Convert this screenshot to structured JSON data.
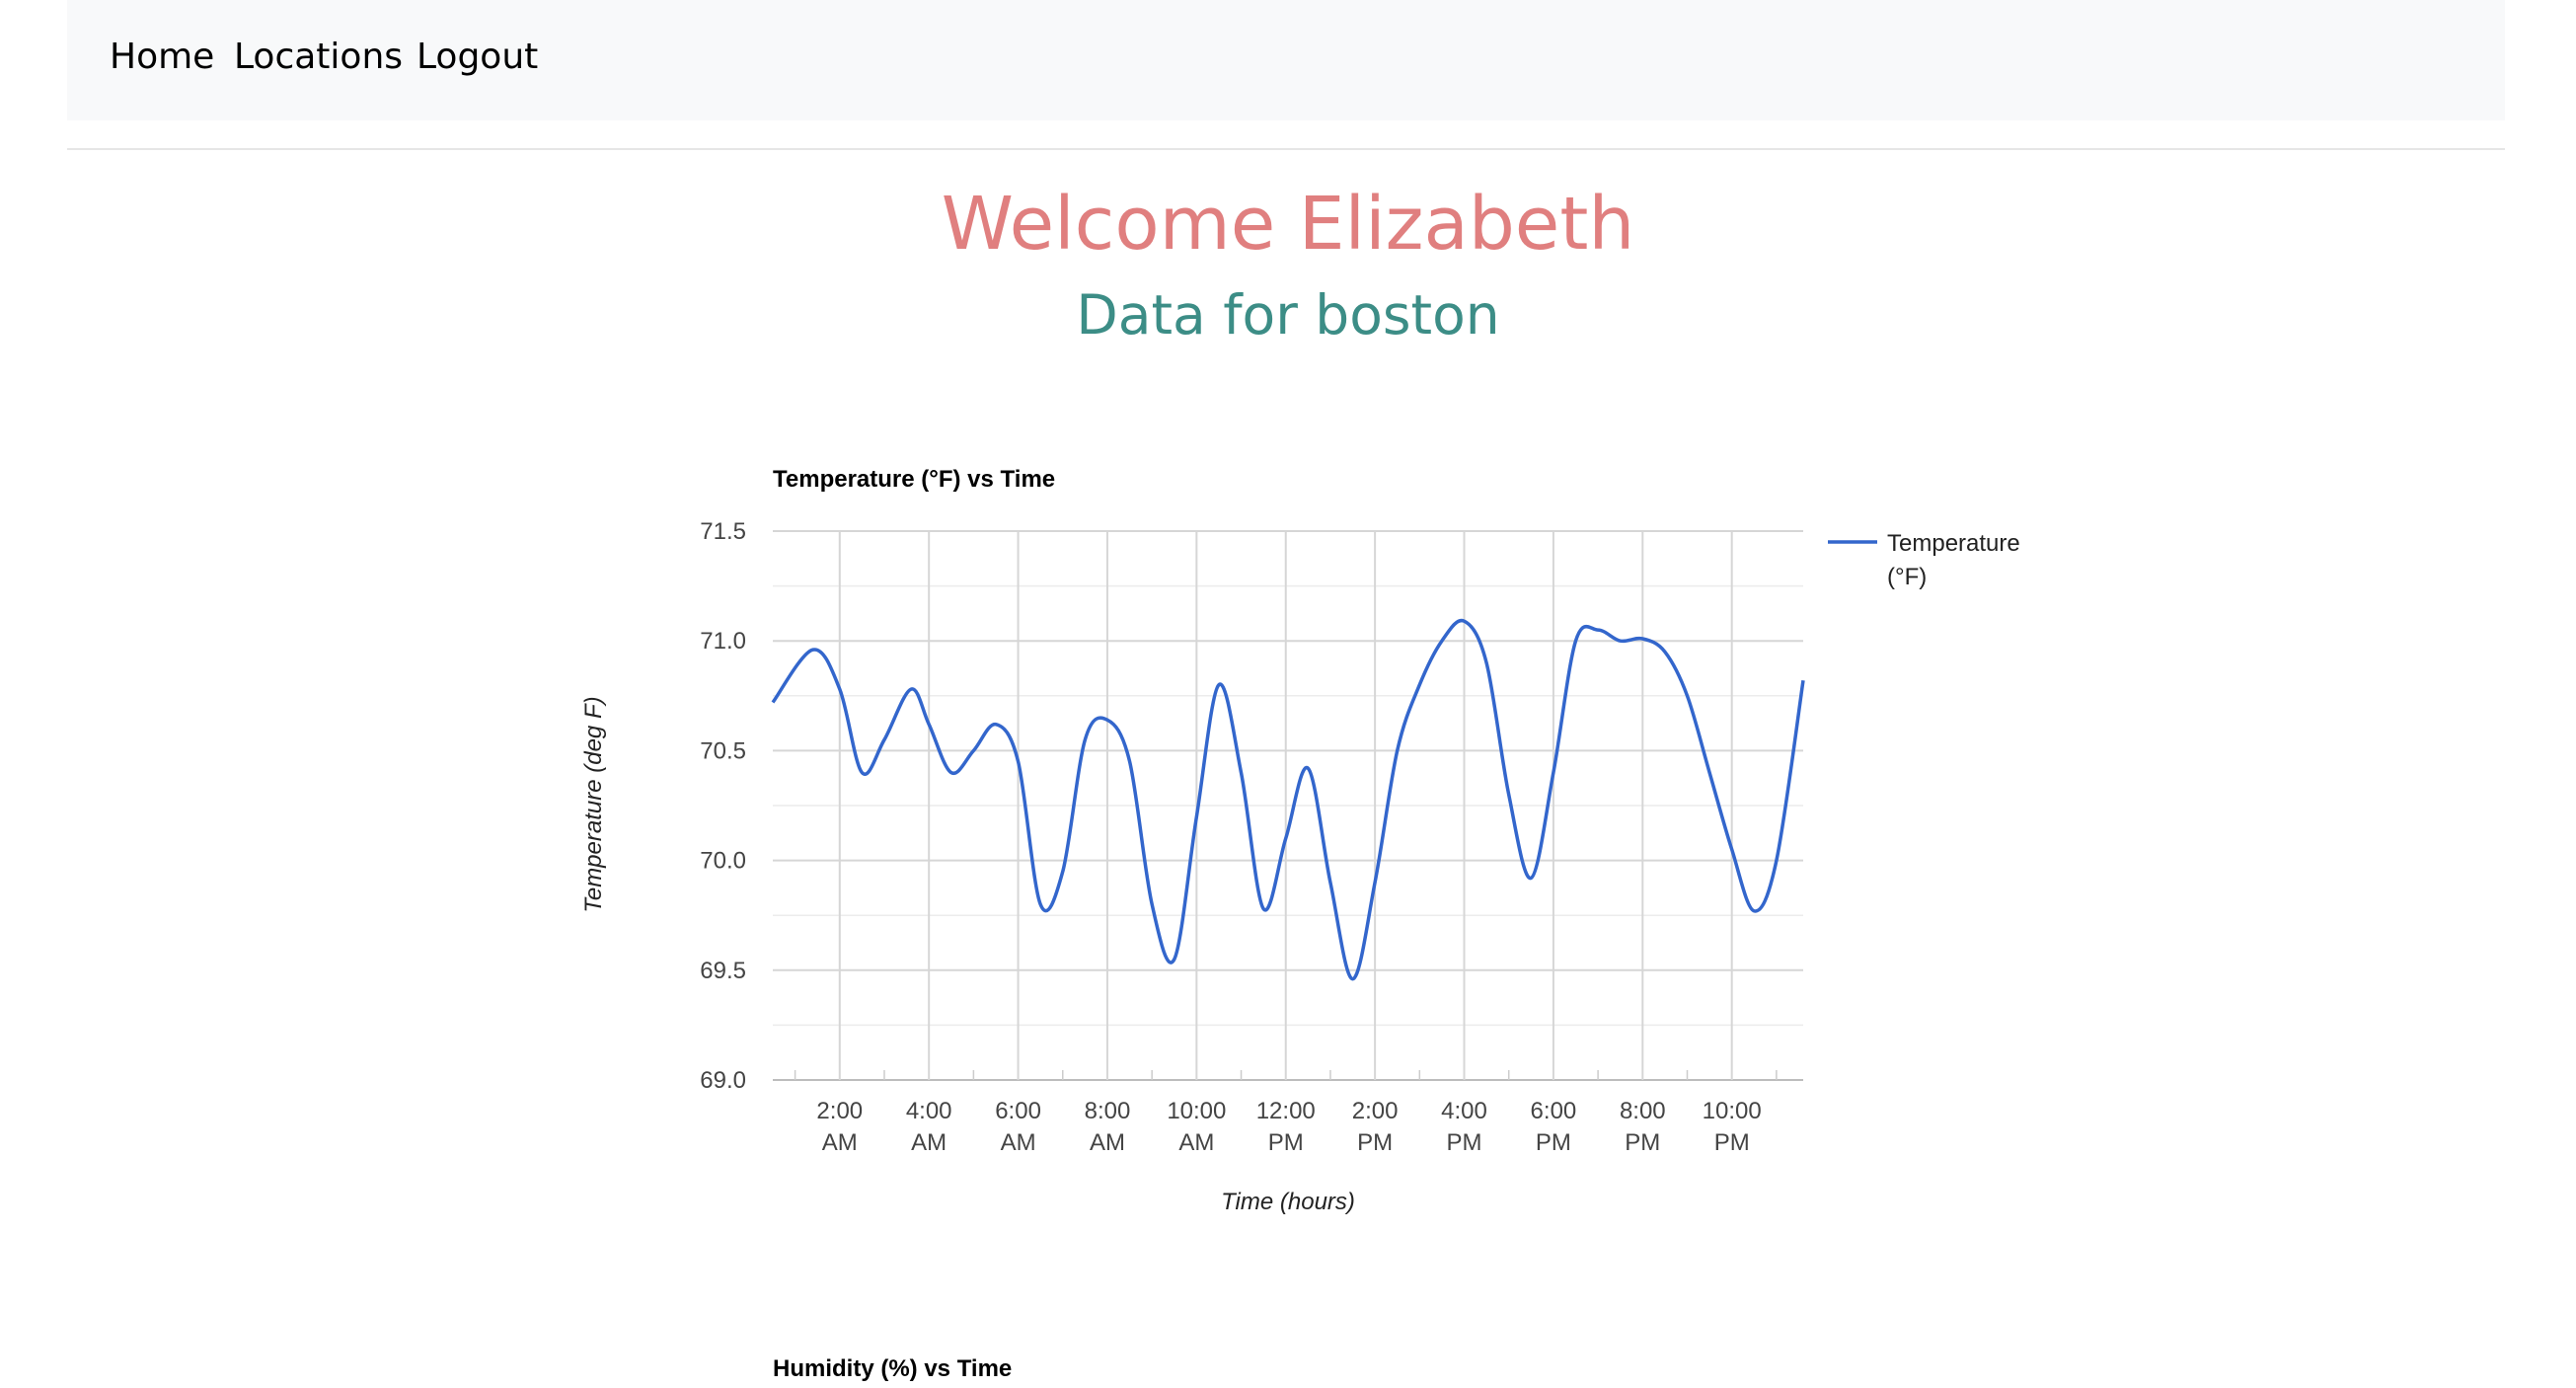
{
  "nav": {
    "items": [
      {
        "label": "Home"
      },
      {
        "label": "Locations"
      },
      {
        "label": "Logout"
      }
    ]
  },
  "header": {
    "welcome": "Welcome Elizabeth",
    "subtitle": "Data for boston"
  },
  "colors": {
    "welcome": "#e07f7f",
    "subtitle": "#3c8d86",
    "series": "#3366cc"
  },
  "chart_data": [
    {
      "type": "line",
      "title": "Temperature (°F) vs Time",
      "xlabel": "Time (hours)",
      "ylabel": "Temperature (deg F)",
      "ylim": [
        69.0,
        71.5
      ],
      "xlim_hours": [
        0.5,
        23.6
      ],
      "yticks": [
        "71.5",
        "71.0",
        "70.5",
        "70.0",
        "69.5",
        "69.0"
      ],
      "xticks": [
        {
          "hour": 2,
          "lines": [
            "2:00",
            "AM"
          ]
        },
        {
          "hour": 4,
          "lines": [
            "4:00",
            "AM"
          ]
        },
        {
          "hour": 6,
          "lines": [
            "6:00",
            "AM"
          ]
        },
        {
          "hour": 8,
          "lines": [
            "8:00",
            "AM"
          ]
        },
        {
          "hour": 10,
          "lines": [
            "10:00",
            "AM"
          ]
        },
        {
          "hour": 12,
          "lines": [
            "12:00",
            "PM"
          ]
        },
        {
          "hour": 14,
          "lines": [
            "2:00",
            "PM"
          ]
        },
        {
          "hour": 16,
          "lines": [
            "4:00",
            "PM"
          ]
        },
        {
          "hour": 18,
          "lines": [
            "6:00",
            "PM"
          ]
        },
        {
          "hour": 20,
          "lines": [
            "8:00",
            "PM"
          ]
        },
        {
          "hour": 22,
          "lines": [
            "10:00",
            "PM"
          ]
        }
      ],
      "legend": {
        "position": "right",
        "lines": [
          "Temperature",
          "(°F)"
        ]
      },
      "grid": true,
      "series": [
        {
          "name": "Temperature (°F)",
          "x_hours": [
            0.5,
            1.4,
            2.0,
            2.5,
            3.0,
            3.6,
            4.0,
            4.5,
            5.0,
            5.5,
            6.0,
            6.5,
            7.0,
            7.5,
            8.0,
            8.5,
            9.0,
            9.5,
            10.0,
            10.5,
            11.0,
            11.5,
            12.0,
            12.5,
            13.0,
            13.5,
            14.0,
            14.5,
            15.0,
            15.5,
            16.0,
            16.5,
            17.0,
            17.5,
            18.0,
            18.5,
            19.0,
            19.5,
            20.0,
            20.5,
            21.0,
            21.5,
            22.0,
            22.5,
            23.0,
            23.6
          ],
          "values": [
            70.72,
            70.96,
            70.78,
            70.4,
            70.55,
            70.78,
            70.62,
            70.4,
            70.5,
            70.62,
            70.45,
            69.8,
            69.95,
            70.55,
            70.64,
            70.45,
            69.8,
            69.55,
            70.2,
            70.8,
            70.4,
            69.78,
            70.1,
            70.42,
            69.9,
            69.46,
            69.9,
            70.5,
            70.8,
            71.0,
            71.09,
            70.9,
            70.3,
            69.92,
            70.4,
            71.0,
            71.05,
            71.0,
            71.01,
            70.95,
            70.75,
            70.4,
            70.05,
            69.77,
            70.0,
            70.82
          ]
        }
      ]
    },
    {
      "type": "line",
      "title": "Humidity (%) vs Time"
    }
  ]
}
